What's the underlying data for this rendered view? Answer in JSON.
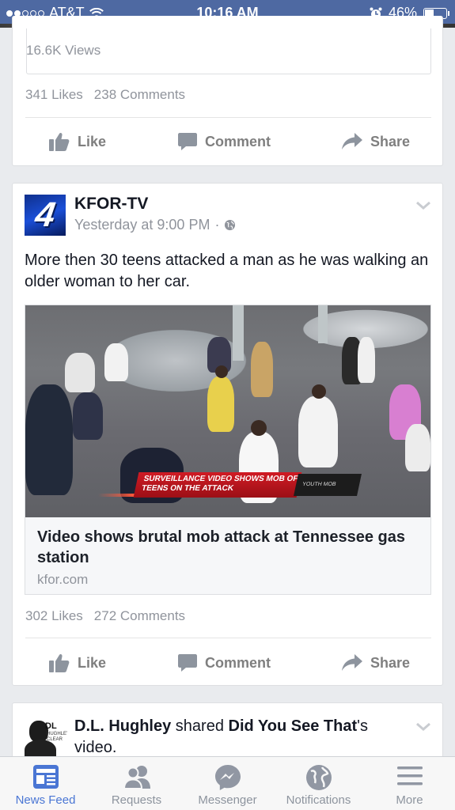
{
  "status_bar": {
    "carrier": "AT&T",
    "time": "10:16 AM",
    "battery": "46%",
    "battery_level": 0.46,
    "signal_bars": 2
  },
  "post_1_footer": {
    "views": "16.6K Views",
    "likes": "341 Likes",
    "comments": "238 Comments"
  },
  "actions": {
    "like": "Like",
    "comment": "Comment",
    "share": "Share"
  },
  "post_2": {
    "author": "KFOR-TV",
    "timestamp": "Yesterday at 9:00 PM",
    "separator": "·",
    "avatar_text": "4",
    "text": "More then 30 teens attacked a man as he was walking an older woman to her car.",
    "video_banner": "SURVEILLANCE VIDEO SHOWS MOB OF TEENS ON THE ATTACK",
    "video_tag": "YOUTH MOB",
    "link_title": "Video shows brutal mob attack at Tennessee gas station",
    "link_domain": "kfor.com",
    "likes": "302 Likes",
    "comments": "272 Comments"
  },
  "post_3": {
    "author": "D.L. Hughley",
    "verb": "shared",
    "page": "Did You See That",
    "suffix": "'s video.",
    "avatar_text": "DL",
    "avatar_subtext": "HUGHLEY CLEAR"
  },
  "tab_bar": [
    {
      "label": "News Feed",
      "icon": "news-feed-icon",
      "active": true
    },
    {
      "label": "Requests",
      "icon": "friend-requests-icon",
      "active": false
    },
    {
      "label": "Messenger",
      "icon": "messenger-icon",
      "active": false
    },
    {
      "label": "Notifications",
      "icon": "globe-icon",
      "active": false
    },
    {
      "label": "More",
      "icon": "menu-icon",
      "active": false
    }
  ],
  "colors": {
    "facebook_blue": "#4e69a2",
    "active_tab": "#4a76d4",
    "muted_text": "#90949c",
    "banner_red": "#d01b24"
  }
}
